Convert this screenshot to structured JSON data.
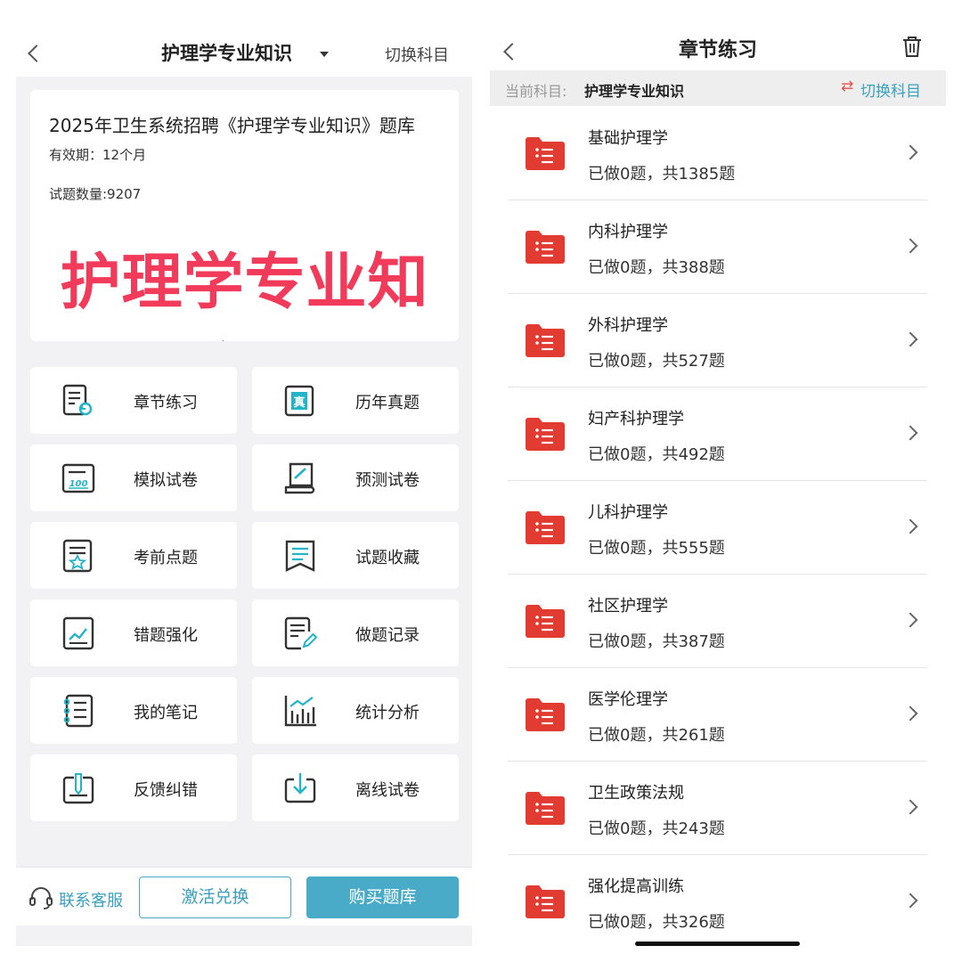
{
  "left": {
    "subject_title": "护理学专业知识",
    "switch_label": "切换科目",
    "banner": {
      "title": "2025年卫生系统招聘《护理学专业知识》题库",
      "validity": "有效期：12个月",
      "question_count": "试题数量:9207",
      "big_text": "护理学专业知识"
    },
    "menu": [
      {
        "label": "章节练习",
        "icon": "chapter-practice-icon"
      },
      {
        "label": "历年真题",
        "icon": "past-exam-icon"
      },
      {
        "label": "模拟试卷",
        "icon": "mock-paper-icon"
      },
      {
        "label": "预测试卷",
        "icon": "forecast-paper-icon"
      },
      {
        "label": "考前点题",
        "icon": "pre-exam-star-icon"
      },
      {
        "label": "试题收藏",
        "icon": "bookmark-icon"
      },
      {
        "label": "错题强化",
        "icon": "wrong-question-chart-icon"
      },
      {
        "label": "做题记录",
        "icon": "edit-record-icon"
      },
      {
        "label": "我的笔记",
        "icon": "notebook-icon"
      },
      {
        "label": "统计分析",
        "icon": "bar-chart-icon"
      },
      {
        "label": "反馈纠错",
        "icon": "feedback-pen-icon"
      },
      {
        "label": "离线试卷",
        "icon": "download-icon"
      }
    ],
    "footer": {
      "service_label": "联系客服",
      "activate_label": "激活兑换",
      "buy_label": "购买题库"
    }
  },
  "right": {
    "title": "章节练习",
    "current_label": "当前科目:",
    "current_subject": "护理学专业知识",
    "switch_label": "切换科目",
    "chapters": [
      {
        "name": "基础护理学",
        "progress": "已做0题，共1385题"
      },
      {
        "name": "内科护理学",
        "progress": "已做0题，共388题"
      },
      {
        "name": "外科护理学",
        "progress": "已做0题，共527题"
      },
      {
        "name": "妇产科护理学",
        "progress": "已做0题，共492题"
      },
      {
        "name": "儿科护理学",
        "progress": "已做0题，共555题"
      },
      {
        "name": "社区护理学",
        "progress": "已做0题，共387题"
      },
      {
        "name": "医学伦理学",
        "progress": "已做0题，共261题"
      },
      {
        "name": "卫生政策法规",
        "progress": "已做0题，共243题"
      },
      {
        "name": "强化提高训练",
        "progress": "已做0题，共326题"
      }
    ]
  },
  "colors": {
    "accent": "#4aabc8",
    "banner_red": "#f23a5a",
    "folder_red": "#e23b32"
  }
}
